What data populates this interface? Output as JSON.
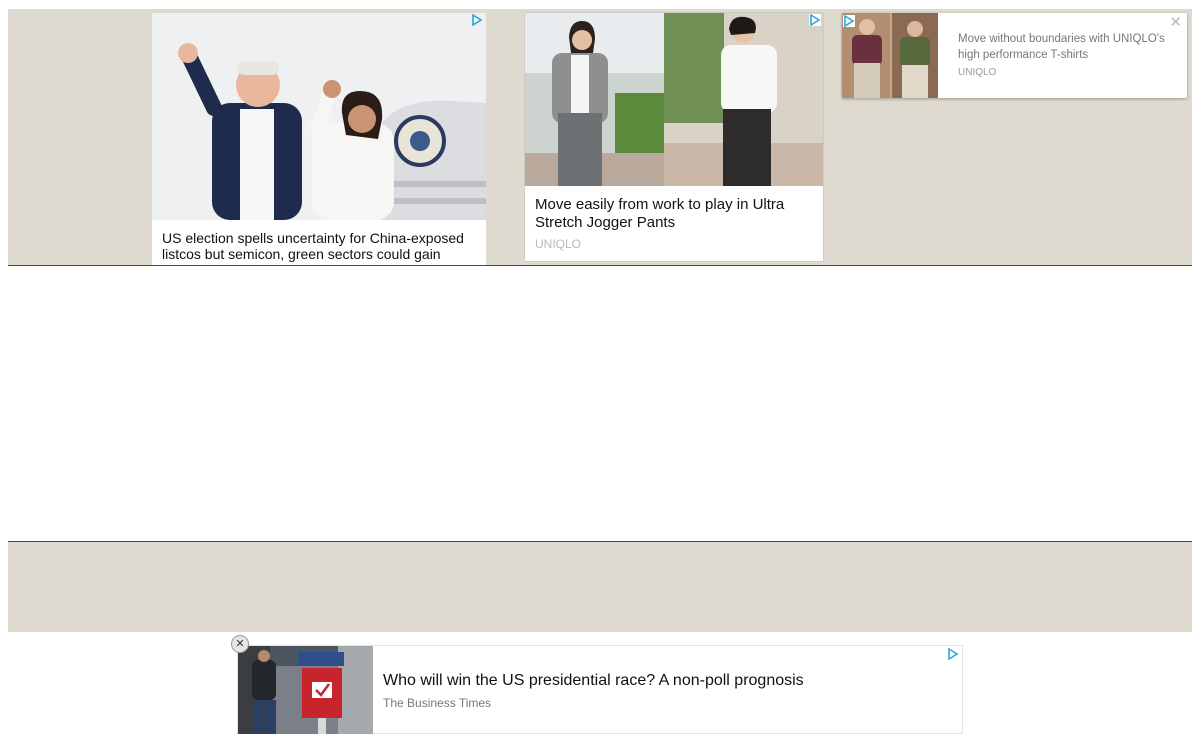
{
  "ad1": {
    "title": "US election spells uncertainty for China-exposed listcos but semicon, green sectors could gain",
    "image": "politicians-waving-airplane-stairs"
  },
  "ad2": {
    "title": "Move easily from work to play in Ultra Stretch Jogger Pants",
    "source": "UNIQLO",
    "image": "fashion-models-street"
  },
  "ad3": {
    "title": "Move without boundaries with UNIQLO's high performance T-shirts",
    "source": "UNIQLO",
    "close_label": "✕",
    "image": "models-tshirts"
  },
  "bottom_ad": {
    "title": "Who will win the US presidential race? A non-poll prognosis",
    "source": "The Business Times",
    "close_label": "✕",
    "image": "ballot-box-street"
  },
  "colors": {
    "band": "#dedad0",
    "adchoice": "#2aa9d6"
  },
  "icons": {
    "adchoice": "adchoices-icon",
    "close": "close-icon"
  }
}
